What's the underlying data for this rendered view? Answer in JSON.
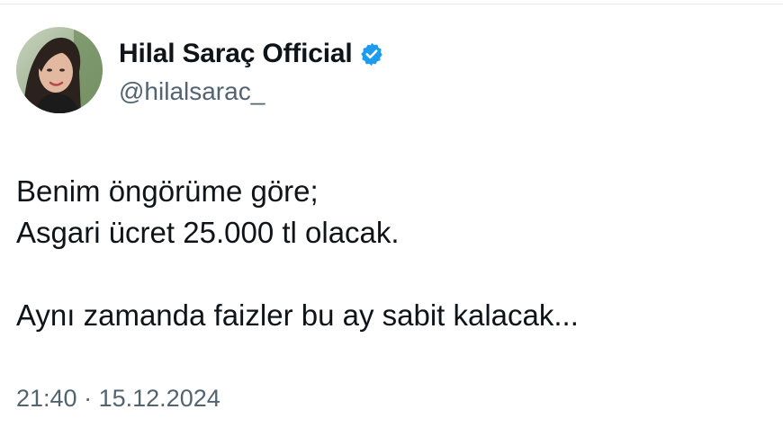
{
  "author": {
    "display_name": "Hilal Saraç Official",
    "handle": "@hilalsarac_",
    "verified": true,
    "verified_color": "#1d9bf0"
  },
  "tweet": {
    "lines": [
      "Benim öngörüme göre;",
      "Asgari ücret 25.000 tl olacak.",
      "",
      "Aynı zamanda faizler bu ay sabit kalacak..."
    ]
  },
  "meta": {
    "time": "21:40",
    "separator": "·",
    "date": "15.12.2024"
  },
  "colors": {
    "text": "#0f1419",
    "secondary": "#536471",
    "border": "#e7e9ea"
  }
}
